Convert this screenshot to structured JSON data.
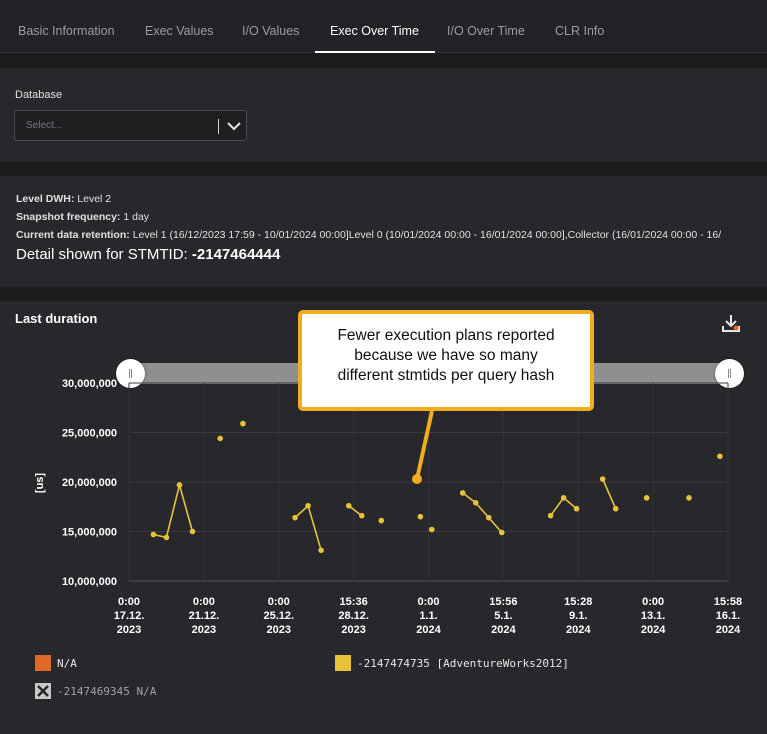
{
  "tabs": [
    {
      "label": "Basic Information",
      "active": false
    },
    {
      "label": "Exec Values",
      "active": false
    },
    {
      "label": "I/O Values",
      "active": false
    },
    {
      "label": "Exec Over Time",
      "active": true
    },
    {
      "label": "I/O Over Time",
      "active": false
    },
    {
      "label": "CLR Info",
      "active": false
    }
  ],
  "filter": {
    "database_label": "Database",
    "database_placeholder": "Select..."
  },
  "info": {
    "level_dwh_key": "Level DWH:",
    "level_dwh_value": "Level 2",
    "snapshot_key": "Snapshot frequency:",
    "snapshot_value": "1 day",
    "retention_key": "Current data retention:",
    "retention_value": "Level 1 (16/12/2023 17:59 - 10/01/2024 00:00]Level 0 (10/01/2024 00:00 - 16/01/2024 00:00],Collector (16/01/2024 00:00 - 16/",
    "detail_prefix": "Detail shown for STMTID:",
    "detail_value": "-2147464444"
  },
  "chart_panel": {
    "title": "Last duration",
    "download_icon": "download-icon"
  },
  "callout": {
    "lines": [
      "Fewer execution plans reported",
      "because we have so many",
      "different stmtids per query hash"
    ],
    "border_color": "#f2ad1f"
  },
  "chart_data": {
    "type": "line",
    "ylabel": "[us]",
    "ylim": [
      10000000,
      30000000
    ],
    "y_ticks": [
      "10,000,000",
      "15,000,000",
      "20,000,000",
      "25,000,000",
      "30,000,000"
    ],
    "x_ticks": [
      [
        "0:00",
        "17.12.",
        "2023"
      ],
      [
        "0:00",
        "21.12.",
        "2023"
      ],
      [
        "0:00",
        "25.12.",
        "2023"
      ],
      [
        "15:36",
        "28.12.",
        "2023"
      ],
      [
        "0:00",
        "1.1.",
        "2024"
      ],
      [
        "15:56",
        "5.1.",
        "2024"
      ],
      [
        "15:28",
        "9.1.",
        "2024"
      ],
      [
        "0:00",
        "13.1.",
        "2024"
      ],
      [
        "15:58",
        "16.1.",
        "2024"
      ]
    ],
    "grid": true,
    "series": [
      {
        "name": "-2147474735 [AdventureWorks2012]",
        "color": "#e8c33a",
        "segments": [
          [
            [
              "2023-12-18 06:00",
              14700000
            ],
            [
              "2023-12-18 22:00",
              14400000
            ],
            [
              "2023-12-19 14:00",
              19700000
            ],
            [
              "2023-12-20 06:00",
              15000000
            ]
          ],
          [
            [
              "2023-12-21 16:00",
              24400000
            ]
          ],
          [
            [
              "2023-12-22 20:00",
              25900000
            ]
          ],
          [
            [
              "2023-12-25 12:00",
              16400000
            ],
            [
              "2023-12-26 04:00",
              17600000
            ],
            [
              "2023-12-26 20:00",
              13100000
            ]
          ],
          [
            [
              "2023-12-28 06:00",
              17600000
            ],
            [
              "2023-12-28 22:00",
              16600000
            ]
          ],
          [
            [
              "2023-12-29 22:00",
              16100000
            ]
          ],
          [
            [
              "2023-12-31 22:00",
              16500000
            ]
          ],
          [
            [
              "2024-01-01 12:00",
              15200000
            ]
          ],
          [
            [
              "2024-01-03 02:00",
              18900000
            ],
            [
              "2024-01-03 18:00",
              17900000
            ],
            [
              "2024-01-04 10:00",
              16400000
            ],
            [
              "2024-01-05 02:00",
              14900000
            ]
          ],
          [
            [
              "2024-01-07 14:00",
              16600000
            ],
            [
              "2024-01-08 06:00",
              18400000
            ],
            [
              "2024-01-08 22:00",
              17300000
            ]
          ],
          [
            [
              "2024-01-10 06:00",
              20300000
            ],
            [
              "2024-01-10 22:00",
              17300000
            ]
          ],
          [
            [
              "2024-01-12 12:00",
              18400000
            ]
          ],
          [
            [
              "2024-01-14 16:00",
              18400000
            ]
          ],
          [
            [
              "2024-01-16 06:00",
              22600000
            ]
          ]
        ]
      }
    ],
    "legend": [
      {
        "label": "N/A",
        "color": "#e0692a"
      },
      {
        "label": "-2147474735 [AdventureWorks2012]",
        "color": "#e8c33a"
      },
      {
        "label": "-2147469345 N/A",
        "color": "#c8c8c8",
        "icon": "disabled-x-icon"
      }
    ],
    "legend_placement": "bottom"
  }
}
